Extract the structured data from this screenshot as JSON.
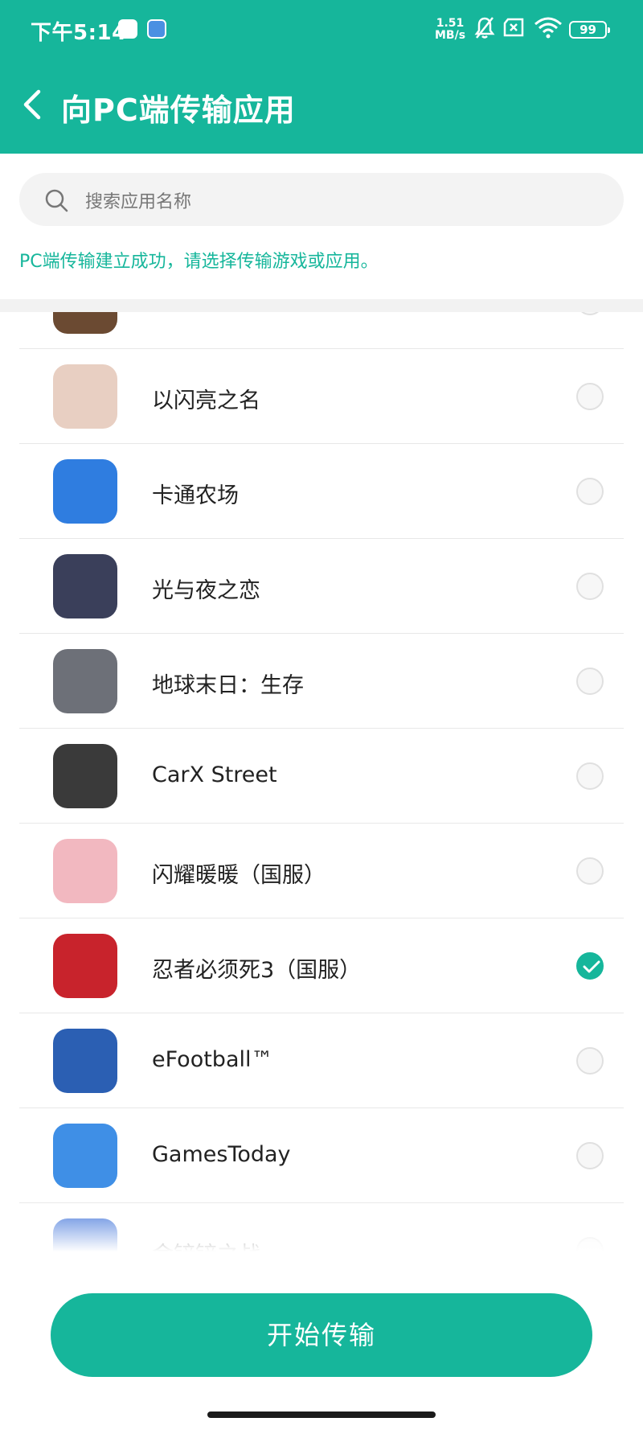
{
  "status_bar": {
    "time": "下午5:14",
    "speed_value": "1.51",
    "speed_unit": "MB/s",
    "battery": "99"
  },
  "header": {
    "title": "向PC端传输应用",
    "back_icon": "chevron-left-icon"
  },
  "search": {
    "placeholder": "搜索应用名称",
    "icon": "search-icon"
  },
  "notice": "PC端传输建立成功，请选择传输游戏或应用。",
  "apps": [
    {
      "name": "",
      "selected": false,
      "icon_color": "#6b4a32"
    },
    {
      "name": "以闪亮之名",
      "selected": false,
      "icon_color": "#e8cfc2"
    },
    {
      "name": "卡通农场",
      "selected": false,
      "icon_color": "#2f7de0"
    },
    {
      "name": "光与夜之恋",
      "selected": false,
      "icon_color": "#3a3f5a"
    },
    {
      "name": "地球末日：生存",
      "selected": false,
      "icon_color": "#6d7078"
    },
    {
      "name": "CarX Street",
      "selected": false,
      "icon_color": "#3a3a3a"
    },
    {
      "name": "闪耀暖暖（国服）",
      "selected": false,
      "icon_color": "#f2b8c0"
    },
    {
      "name": "忍者必须死3（国服）",
      "selected": true,
      "icon_color": "#c8232c"
    },
    {
      "name": "eFootball™",
      "selected": false,
      "icon_color": "#2b5fb3"
    },
    {
      "name": "GamesToday",
      "selected": false,
      "icon_color": "#3f8fe6"
    },
    {
      "name": "金铲铲之战",
      "selected": false,
      "icon_color": "#3a6fd8"
    }
  ],
  "colors": {
    "accent": "#16b69b"
  },
  "start_button": "开始传输"
}
